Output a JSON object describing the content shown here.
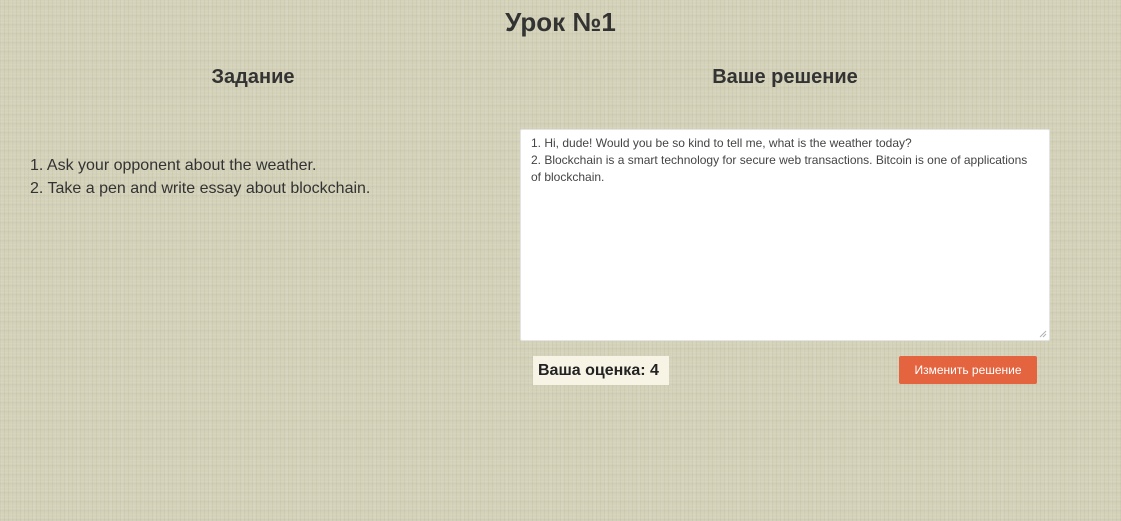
{
  "page": {
    "title": "Урок №1"
  },
  "task": {
    "heading": "Задание",
    "items": [
      "1. Ask your opponent about the weather.",
      "2. Take a pen and write essay about blockchain."
    ]
  },
  "solution": {
    "heading": "Ваше решение",
    "lines": [
      "1. Hi, dude! Would you be so kind to tell me, what is the weather today?",
      "2. Blockchain is a smart technology for secure web transactions. Bitcoin is one of applications of blockchain."
    ],
    "resize_icon": "resize-grip-icon"
  },
  "grade": {
    "label": "Ваша оценка: 4"
  },
  "actions": {
    "change_label": "Изменить решение"
  },
  "colors": {
    "background": "#d4d2b9",
    "accent_button": "#e4643f",
    "grade_background": "#f7f4e6",
    "text": "#333333"
  }
}
